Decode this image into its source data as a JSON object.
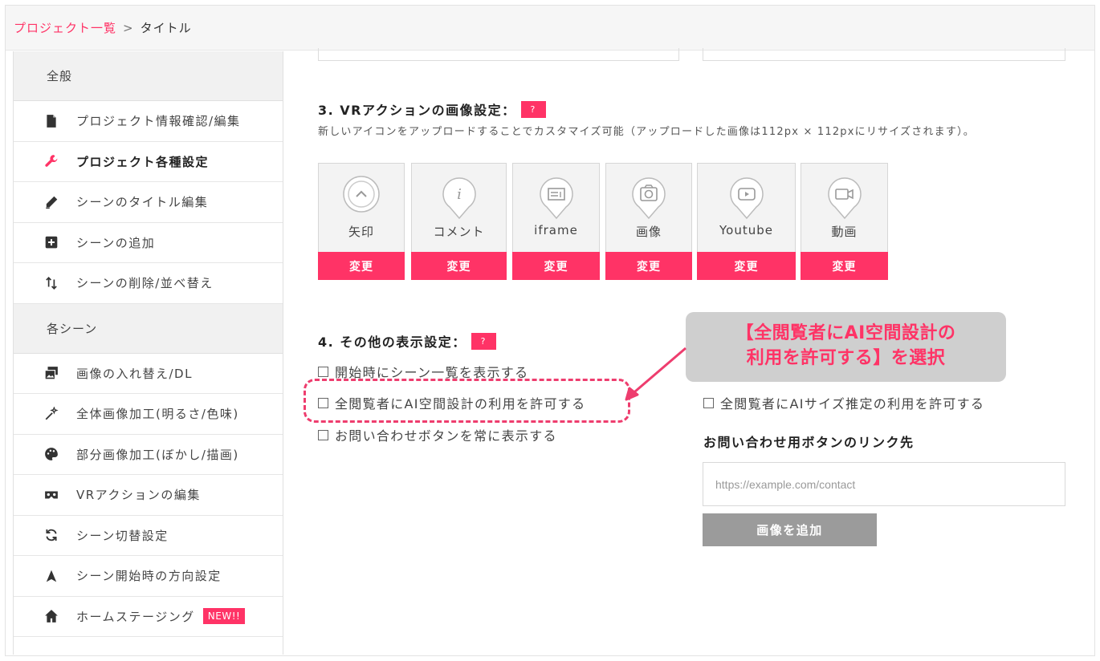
{
  "breadcrumb": {
    "link": "プロジェクト一覧",
    "sep": ">",
    "current": "タイトル"
  },
  "sidebar": {
    "section_general": "全般",
    "general_items": [
      {
        "label": "プロジェクト情報確認/編集",
        "icon": "document-icon"
      },
      {
        "label": "プロジェクト各種設定",
        "icon": "wrench-icon"
      },
      {
        "label": "シーンのタイトル編集",
        "icon": "pencil-icon"
      },
      {
        "label": "シーンの追加",
        "icon": "plus-square-icon"
      },
      {
        "label": "シーンの削除/並べ替え",
        "icon": "sort-icon"
      }
    ],
    "section_scenes": "各シーン",
    "scene_items": [
      {
        "label": "画像の入れ替え/DL",
        "icon": "images-icon"
      },
      {
        "label": "全体画像加工(明るさ/色味)",
        "icon": "magic-wand-icon"
      },
      {
        "label": "部分画像加工(ぼかし/描画)",
        "icon": "palette-icon"
      },
      {
        "label": "VRアクションの編集",
        "icon": "vr-goggles-icon"
      },
      {
        "label": "シーン切替設定",
        "icon": "refresh-icon"
      },
      {
        "label": "シーン開始時の方向設定",
        "icon": "navigation-arrow-icon"
      },
      {
        "label": "ホームステージング",
        "icon": "home-icon",
        "badge": "NEW!!"
      }
    ]
  },
  "section3": {
    "title": "3. VRアクションの画像設定：",
    "help": "?",
    "description": "新しいアイコンをアップロードすることでカスタマイズ可能（アップロードした画像は112px × 112pxにリサイズされます）。",
    "cards": [
      {
        "label": "矢印",
        "icon": "chevron-up-icon",
        "button": "変更"
      },
      {
        "label": "コメント",
        "icon": "info-icon",
        "button": "変更"
      },
      {
        "label": "iframe",
        "icon": "iframe-icon",
        "button": "変更"
      },
      {
        "label": "画像",
        "icon": "camera-icon",
        "button": "変更"
      },
      {
        "label": "Youtube",
        "icon": "play-icon",
        "button": "変更"
      },
      {
        "label": "動画",
        "icon": "video-icon",
        "button": "変更"
      }
    ]
  },
  "section4": {
    "title": "4. その他の表示設定：",
    "help": "?",
    "checkboxes": [
      "開始時にシーン一覧を表示する",
      "全閲覧者にAI空間設計の利用を許可する",
      "お問い合わせボタンを常に表示する"
    ],
    "right_checkbox": "全閲覧者にAIサイズ推定の利用を許可する",
    "link_label": "お問い合わせ用ボタンのリンク先",
    "link_placeholder": "https://example.com/contact",
    "add_button": "画像を追加"
  },
  "callout": {
    "line1": "【全閲覧者にAI空間設計の",
    "line2": "利用を許可する】を選択"
  },
  "colors": {
    "accent": "#ff3366",
    "annotation": "#ee3d6e",
    "callout_bg": "#cfcfcf"
  }
}
